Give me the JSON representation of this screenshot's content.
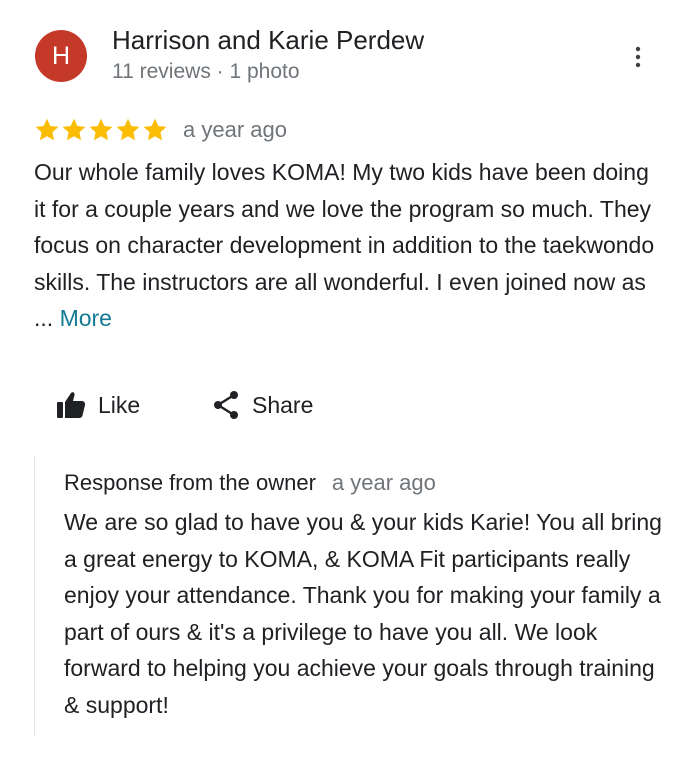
{
  "reviewer": {
    "initial": "H",
    "name": "Harrison and Karie Perdew",
    "meta": "11 reviews · 1 photo",
    "avatar_color": "#c53929"
  },
  "review": {
    "rating": 5,
    "max_rating": 5,
    "time": "a year ago",
    "text": "Our whole family loves KOMA! My two kids have been doing it for a couple years and we love the program so much. They focus on character development in addition to the taekwondo skills. The instructors are all wonderful. I even joined now as ...",
    "more_label": "More"
  },
  "actions": {
    "like_label": "Like",
    "share_label": "Share"
  },
  "owner_response": {
    "title": "Response from the owner",
    "time": "a year ago",
    "text": "We are so glad to have you & your kids Karie! You all bring a great energy to KOMA, & KOMA Fit participants really enjoy your attendance. Thank you for making your family a part of ours & it's a privilege to have you all. We look forward to helping you achieve your goals through training & support!"
  },
  "colors": {
    "star": "#fbbc04",
    "link": "#137a94",
    "secondary_text": "#70757a"
  },
  "icons": {
    "more": "more-vert-icon",
    "like": "thumb-up-icon",
    "share": "share-icon",
    "star": "star-icon"
  }
}
